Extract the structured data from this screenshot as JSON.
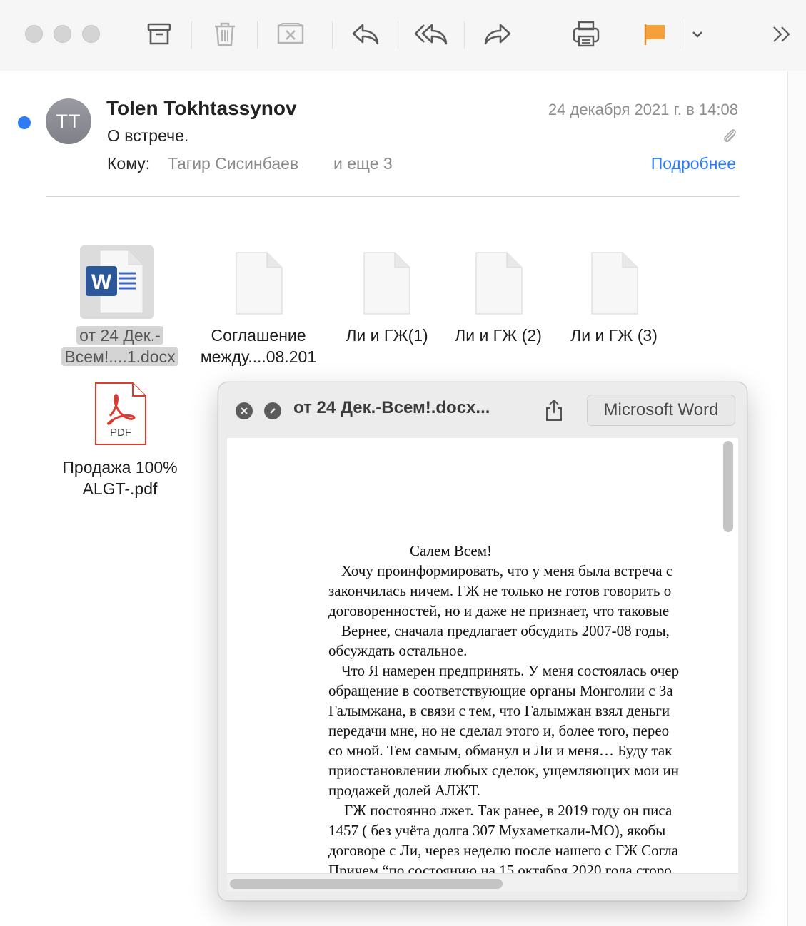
{
  "toolbar": {
    "buttons": [
      {
        "name": "archive",
        "icon": "archive-box-icon"
      },
      {
        "name": "delete",
        "icon": "trash-icon"
      },
      {
        "name": "junk",
        "icon": "junk-box-icon"
      },
      {
        "name": "reply",
        "icon": "reply-arrow-icon"
      },
      {
        "name": "reply-all",
        "icon": "reply-all-arrow-icon"
      },
      {
        "name": "forward",
        "icon": "forward-arrow-icon"
      },
      {
        "name": "print",
        "icon": "printer-icon"
      },
      {
        "name": "flag",
        "icon": "flag-icon",
        "color": "#f5a03b"
      },
      {
        "name": "flag-menu",
        "icon": "chevron-down-icon"
      },
      {
        "name": "overflow",
        "icon": "double-chevron-right-icon"
      }
    ]
  },
  "message": {
    "avatar_initials": "TT",
    "sender": "Tolen Tokhtassynov",
    "subject": "О встрече.",
    "to_label": "Кому:",
    "to_name": "Тагир Сисинбаев",
    "to_more": "и еще 3",
    "date": "24 декабря 2021 г. в 14:08",
    "details_link": "Подробнее",
    "unread_color": "#2f7bf5",
    "link_color": "#2c7cf5"
  },
  "attachments": [
    {
      "line1": "от 24 Дек.-",
      "line2": "Всем!....1.docx",
      "icon": "word-document-icon",
      "selected": true
    },
    {
      "line1": "Соглашение",
      "line2": "между....08.201",
      "icon": "blank-document-icon"
    },
    {
      "line1": "Ли и ГЖ(1)",
      "line2": "",
      "icon": "blank-document-icon"
    },
    {
      "line1": "Ли и ГЖ (2)",
      "line2": "",
      "icon": "blank-document-icon"
    },
    {
      "line1": "Ли и ГЖ (3)",
      "line2": "",
      "icon": "blank-document-icon"
    },
    {
      "line1": "Продажа 100%",
      "line2": "ALGT-.pdf",
      "icon": "pdf-document-icon",
      "pdf_label": "PDF"
    }
  ],
  "quicklook": {
    "title": "от 24 Дек.-Всем!.docx...",
    "open_with": "Microsoft Word",
    "document_lines": [
      "Салем Всем!",
      "Хочу проинформировать, что у меня была встреча с",
      "закончилась ничем. ГЖ не только не готов говорить о",
      "договоренностей, но и даже не признает, что таковые",
      "Вернее, сначала предлагает обсудить 2007-08 годы,",
      "обсуждать остальное.",
      "Что Я намерен предпринять. У меня состоялась очер",
      "обращение в соответствующие органы Монголии с За",
      "Галымжана, в связи с тем, что Галымжан взял деньги",
      "передачи мне, но не сделал этого и, более того,  перео",
      "со мной. Тем самым, обманул и Ли и меня… Буду так",
      "приостановлении любых сделок, ущемляющих мои ин",
      "продажей долей АЛЖТ.",
      "ГЖ постоянно лжет. Так ранее, в 2019 году он писа",
      "1457 ( без учёта долга 307 Мухаметкали-МО), якобы",
      "договоре с Ли, через неделю после нашего с ГЖ Согла",
      "Причем “по состоянию на 15 октября 2020 года сторо"
    ]
  }
}
